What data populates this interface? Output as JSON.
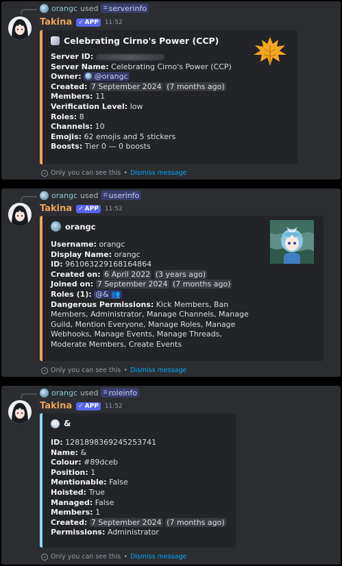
{
  "colors": {
    "accent": "#f0a35a",
    "role_color": "#89dceb",
    "link": "#00a8fc",
    "app_badge": "#5865f2"
  },
  "messages": [
    {
      "reply": {
        "user": "orangc",
        "used": "used",
        "command": "serverinfo"
      },
      "bot": {
        "name": "Takina",
        "badge": "APP",
        "time": "11:52"
      },
      "embed": {
        "title": "Celebrating Cirno's Power (CCP)",
        "fields": [
          {
            "label": "Server ID:",
            "value": ""
          },
          {
            "label": "Server Name:",
            "value": "Celebrating Cirno's Power (CCP)"
          },
          {
            "label": "Owner:",
            "value": "@orangc"
          },
          {
            "label": "Created:",
            "value": "7 September 2024",
            "rel": "(7 months ago)"
          },
          {
            "label": "Members:",
            "value": "11"
          },
          {
            "label": "Verification Level:",
            "value": "low"
          },
          {
            "label": "Roles:",
            "value": "8"
          },
          {
            "label": "Channels:",
            "value": "10"
          },
          {
            "label": "Emojis:",
            "value": "62 emojis and 5 stickers"
          },
          {
            "label": "Boosts:",
            "value": "Tier 0 — 0 boosts"
          }
        ]
      },
      "ephemeral": {
        "text": "Only you can see this",
        "sep": "•",
        "dismiss": "Dismiss message"
      }
    },
    {
      "reply": {
        "user": "orangc",
        "used": "used",
        "command": "userinfo"
      },
      "bot": {
        "name": "Takina",
        "badge": "APP",
        "time": "11:52"
      },
      "embed": {
        "title": "orangc",
        "fields": [
          {
            "label": "Username:",
            "value": "orangc"
          },
          {
            "label": "Display Name:",
            "value": "orangc"
          },
          {
            "label": "ID:",
            "value": "961063229168164864"
          },
          {
            "label": "Created on:",
            "value": "6 April 2022",
            "rel": "(3 years ago)"
          },
          {
            "label": "Joined on:",
            "value": "7 September 2024",
            "rel": "(7 months ago)"
          },
          {
            "label": "Roles (1):",
            "value": "@&"
          },
          {
            "label": "Dangerous Permissions:",
            "value": "Kick Members, Ban"
          },
          {
            "label": "",
            "value": "Members, Administrator, Manage Channels, Manage"
          },
          {
            "label": "",
            "value": "Guild, Mention Everyone, Manage Roles, Manage"
          },
          {
            "label": "",
            "value": "Webhooks, Manage Events, Manage Threads,"
          },
          {
            "label": "",
            "value": "Moderate Members, Create Events"
          }
        ]
      },
      "ephemeral": {
        "text": "Only you can see this",
        "sep": "•",
        "dismiss": "Dismiss message"
      }
    },
    {
      "reply": {
        "user": "orangc",
        "used": "used",
        "command": "roleinfo"
      },
      "bot": {
        "name": "Takina",
        "badge": "APP",
        "time": "11:52"
      },
      "embed": {
        "title": "&",
        "fields": [
          {
            "label": "ID:",
            "value": "1281898369245253741"
          },
          {
            "label": "Name:",
            "value": "&"
          },
          {
            "label": "Colour:",
            "value": "#89dceb"
          },
          {
            "label": "Position:",
            "value": "1"
          },
          {
            "label": "Mentionable:",
            "value": "False"
          },
          {
            "label": "Hoisted:",
            "value": "True"
          },
          {
            "label": "Managed:",
            "value": "False"
          },
          {
            "label": "Members:",
            "value": "1"
          },
          {
            "label": "Created:",
            "value": "7 September 2024",
            "rel": "(7 months ago)"
          },
          {
            "label": "Permissions:",
            "value": "Administrator"
          }
        ]
      },
      "ephemeral": {
        "text": "Only you can see this",
        "sep": "•",
        "dismiss": "Dismiss message"
      }
    }
  ]
}
